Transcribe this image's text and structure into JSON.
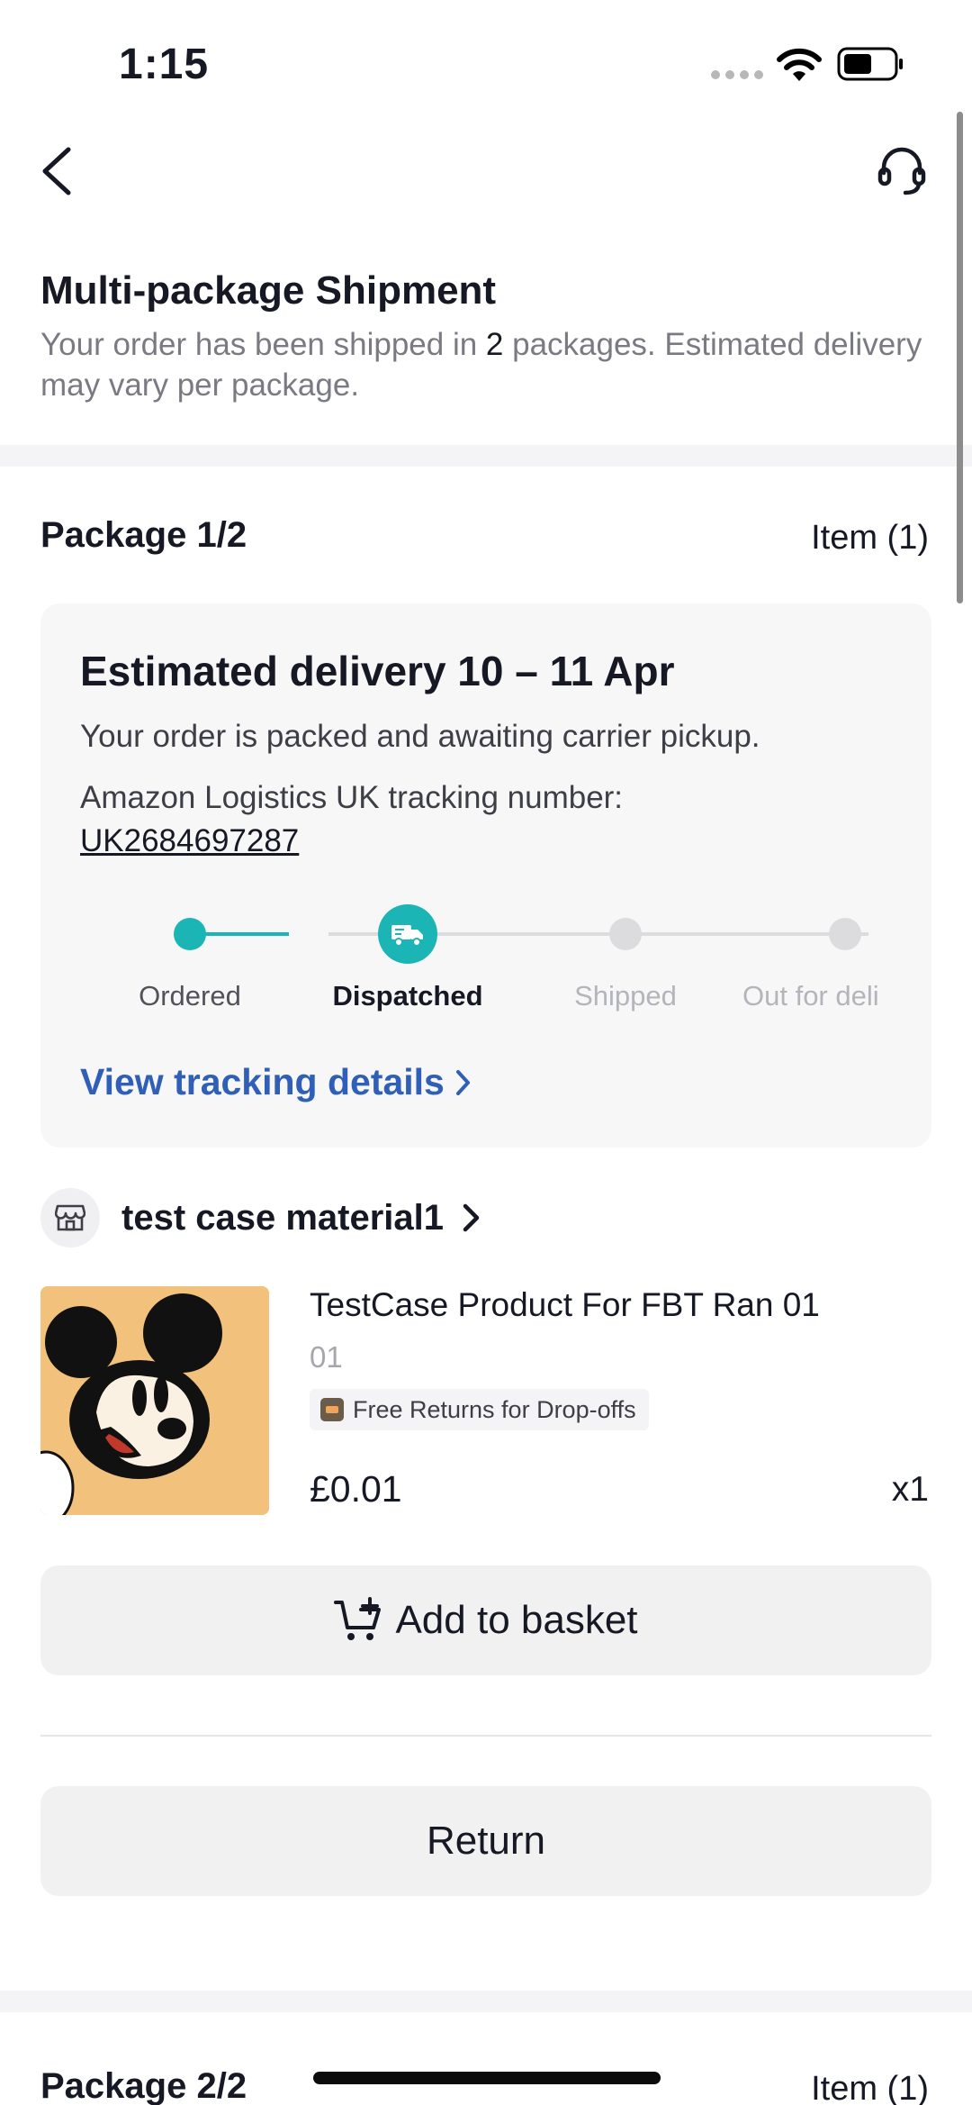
{
  "status_bar": {
    "time": "1:15"
  },
  "header": {
    "title": "Multi-package Shipment",
    "subtitle_before": "Your order has been shipped in ",
    "subtitle_count": "2",
    "subtitle_after": " packages. Estimated delivery may vary per package."
  },
  "package1": {
    "title": "Package 1/2",
    "items": "Item (1)",
    "delivery": {
      "title": "Estimated delivery 10 – 11 Apr",
      "status": "Your order is packed and awaiting carrier pickup.",
      "carrier_line": "Amazon Logistics UK tracking number:",
      "tracking_number": "UK2684697287",
      "steps": [
        {
          "label": "Ordered",
          "state": "done"
        },
        {
          "label": "Dispatched",
          "state": "current"
        },
        {
          "label": "Shipped",
          "state": "pending"
        },
        {
          "label": "Out for deli",
          "state": "pending"
        }
      ],
      "view_tracking": "View tracking details"
    },
    "seller": {
      "name": "test case material1"
    },
    "product": {
      "name": "TestCase Product For FBT Ran 01",
      "variant": "01",
      "badge": "Free Returns for Drop-offs",
      "price": "£0.01",
      "quantity": "x1"
    },
    "add_to_basket": "Add to basket",
    "return": "Return"
  },
  "package2": {
    "title": "Package 2/2",
    "items": "Item (1)"
  },
  "colors": {
    "accent_teal": "#1bb5b5",
    "link_blue": "#2f5fb7",
    "product_bg": "#f2c27c"
  }
}
